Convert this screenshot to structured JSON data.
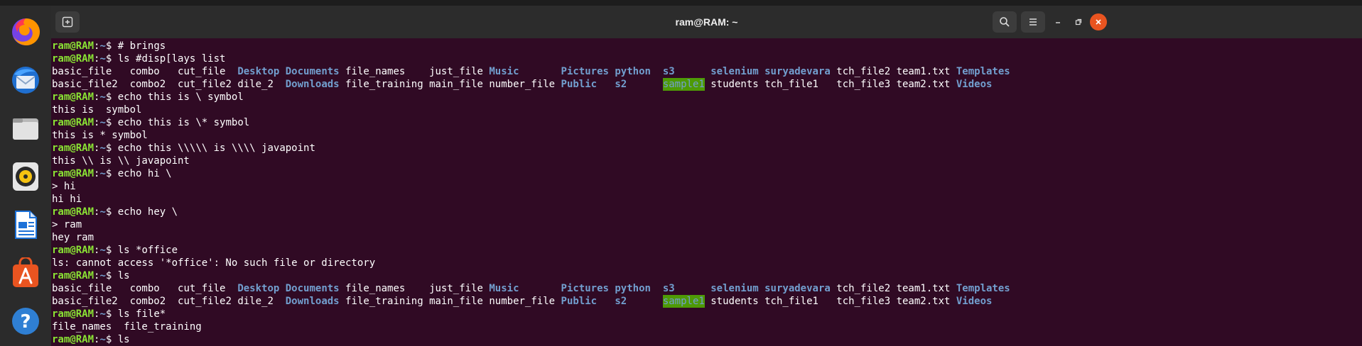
{
  "window": {
    "title": "ram@RAM: ~"
  },
  "dock": [
    {
      "name": "firefox-icon"
    },
    {
      "name": "thunderbird-icon"
    },
    {
      "name": "files-icon"
    },
    {
      "name": "rhythmbox-icon"
    },
    {
      "name": "libreoffice-writer-icon"
    },
    {
      "name": "software-center-icon"
    },
    {
      "name": "help-icon"
    }
  ],
  "prompt": {
    "user": "ram@RAM",
    "path": ":~",
    "symbol": "$ "
  },
  "colors": {
    "background": "#300a24",
    "user": "#8ae234",
    "dir": "#729fcf",
    "highlight": "#4e9a06",
    "close": "#e95420"
  },
  "terminal": {
    "cmd1": "# brings",
    "cmd2": "ls #disp[lays list",
    "cmd3": "echo this is \\ symbol",
    "out3": "this is  symbol",
    "cmd4": "echo this is \\* symbol",
    "out4": "this is * symbol",
    "cmd5": "echo this \\\\\\\\\\ is \\\\\\\\ javapoint",
    "out5": "this \\\\ is \\\\ javapoint",
    "cmd6": "echo hi \\",
    "cont6": "> hi",
    "out6": "hi hi",
    "cmd7": "echo hey \\",
    "cont7": "> ram",
    "out7": "hey ram",
    "cmd8": "ls *office",
    "out8": "ls: cannot access '*office': No such file or directory",
    "cmd9": "ls",
    "cmd10": "ls file*",
    "out10": "file_names  file_training",
    "cmd11": "ls"
  },
  "listing": {
    "row1": [
      "basic_file",
      "combo",
      "cut_file",
      "Desktop",
      "Documents",
      "file_names",
      "just_file",
      "Music",
      "Pictures",
      "python",
      "s3",
      "selenium",
      "suryadevara",
      "tch_file2",
      "team1.txt",
      "Templates"
    ],
    "row2": [
      "basic_file2",
      "combo2",
      "cut_file2",
      "dile_2",
      "Downloads",
      "file_training",
      "main_file",
      "number_file",
      "Public",
      "s2",
      "sample1",
      "students",
      "tch_file1",
      "tch_file3",
      "team2.txt",
      "Videos"
    ]
  }
}
